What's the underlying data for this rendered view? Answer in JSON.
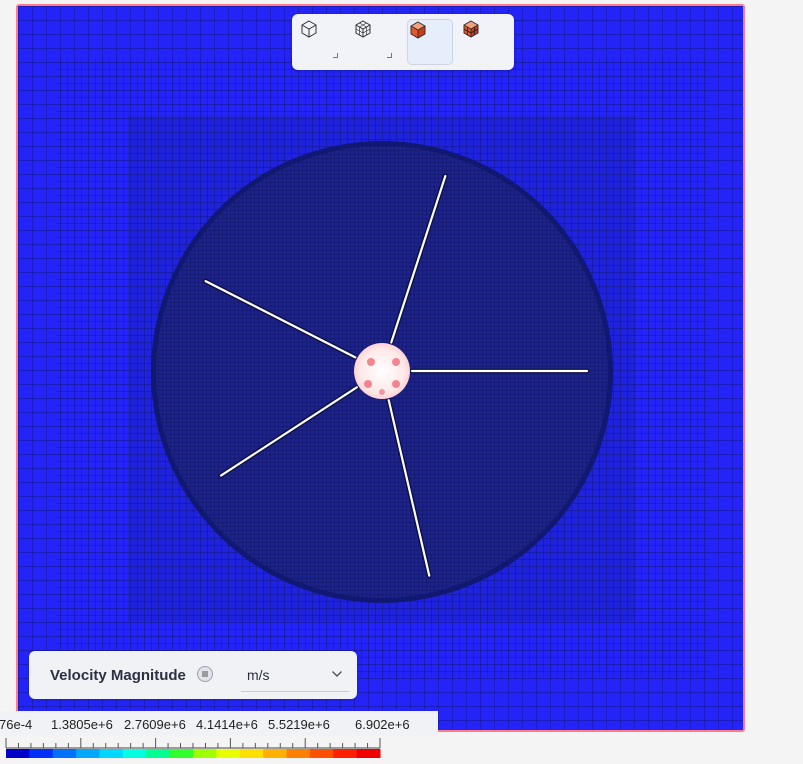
{
  "toolbar": {
    "buttons": [
      {
        "name": "view-wireframe-button",
        "icon": "cube-outline-icon",
        "active": false
      },
      {
        "name": "view-mesh-button",
        "icon": "cube-mesh-icon",
        "active": false
      },
      {
        "name": "view-surface-button",
        "icon": "cube-solid-icon",
        "active": true
      },
      {
        "name": "view-surface-edges-button",
        "icon": "cube-solid-edges-icon",
        "active": false
      }
    ]
  },
  "legend": {
    "field_label": "Velocity Magnitude",
    "unit": "m/s",
    "tick_labels": [
      "76e-4",
      "1.3805e+6",
      "2.7609e+6",
      "4.1414e+6",
      "5.5219e+6",
      "6.902e+6"
    ],
    "colors": [
      "#0000c8",
      "#0030ff",
      "#0070ff",
      "#00a8ff",
      "#00d8ff",
      "#00ffe0",
      "#00ff90",
      "#30ff30",
      "#a0ff00",
      "#e8ff00",
      "#ffe000",
      "#ffb000",
      "#ff8000",
      "#ff5000",
      "#ff2000",
      "#f00000"
    ]
  },
  "colors": {
    "domain_background": "#2424f8",
    "mesh_dark": "#141a6e",
    "blade": "#ffffff",
    "hub": "#ffe6e6",
    "hub_hot": "#f06070"
  }
}
